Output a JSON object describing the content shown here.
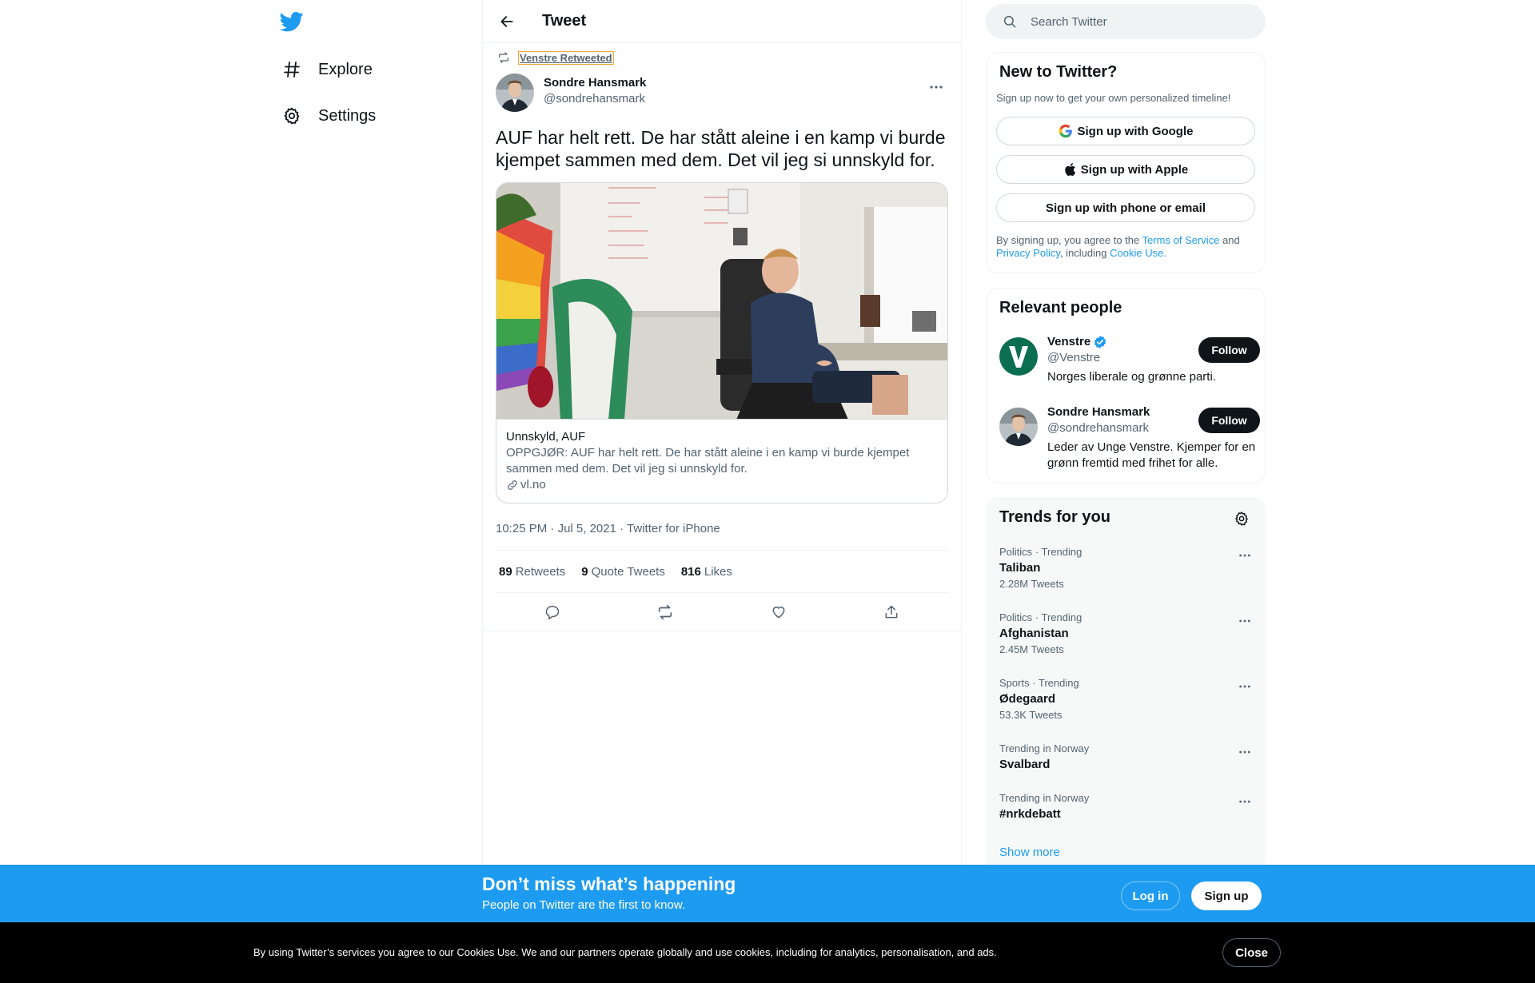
{
  "nav": {
    "logo_icon": "twitter-bird-icon",
    "items": [
      {
        "label": "Explore",
        "icon": "hashtag-icon"
      },
      {
        "label": "Settings",
        "icon": "gear-icon"
      }
    ]
  },
  "header": {
    "title": "Tweet",
    "back_icon": "arrow-left-icon"
  },
  "tweet": {
    "retweeted_by": "Venstre Retweeted",
    "author_name": "Sondre Hansmark",
    "author_handle": "@sondrehansmark",
    "text": "AUF har helt rett. De har stått aleine i en kamp vi burde kjempet sammen med dem. Det vil jeg si unnskyld for.",
    "card": {
      "title": "Unnskyld, AUF",
      "description": "OPPGJØR: AUF har helt rett. De har stått aleine i en kamp vi burde kjempet sammen med dem. Det vil jeg si unnskyld for.",
      "domain": "vl.no"
    },
    "time": "10:25 PM",
    "date": "Jul 5, 2021",
    "separator": "·",
    "source": "Twitter for iPhone",
    "stats": {
      "retweets": "89",
      "retweets_label": "Retweets",
      "quotes": "9",
      "quotes_label": "Quote Tweets",
      "likes": "816",
      "likes_label": "Likes"
    }
  },
  "search": {
    "placeholder": "Search Twitter"
  },
  "new_to_twitter": {
    "title": "New to Twitter?",
    "subtitle": "Sign up now to get your own personalized timeline!",
    "google": "Sign up with Google",
    "apple": "Sign up with Apple",
    "phone": "Sign up with phone or email",
    "legal_1": "By signing up, you agree to the",
    "tos": "Terms of Service",
    "legal_2": "and",
    "privacy": "Privacy Policy",
    "legal_3": ", including",
    "cookie": "Cookie Use."
  },
  "relevant_people": {
    "title": "Relevant people",
    "people": [
      {
        "name": "Venstre",
        "handle": "@Venstre",
        "bio": "Norges liberale og grønne parti.",
        "follow": "Follow",
        "verified": true
      },
      {
        "name": "Sondre Hansmark",
        "handle": "@sondrehansmark",
        "bio": "Leder av Unge Venstre. Kjemper for en grønn fremtid med frihet for alle.",
        "follow": "Follow",
        "verified": false
      }
    ]
  },
  "trends": {
    "title": "Trends for you",
    "items": [
      {
        "meta": "Politics · Trending",
        "name": "Taliban",
        "count": "2.28M Tweets"
      },
      {
        "meta": "Politics · Trending",
        "name": "Afghanistan",
        "count": "2.45M Tweets"
      },
      {
        "meta": "Sports · Trending",
        "name": "Ødegaard",
        "count": "53.3K Tweets"
      },
      {
        "meta": "Trending in Norway",
        "name": "Svalbard",
        "count": ""
      },
      {
        "meta": "Trending in Norway",
        "name": "#nrkdebatt",
        "count": ""
      }
    ],
    "show_more": "Show more"
  },
  "bottom_bar": {
    "title": "Don’t miss what’s happening",
    "subtitle": "People on Twitter are the first to know.",
    "login": "Log in",
    "signup": "Sign up"
  },
  "cookie_bar": {
    "text": "By using Twitter’s services you agree to our Cookies Use. We and our partners operate globally and use cookies, including for analytics, personalisation, and ads.",
    "close": "Close"
  },
  "colors": {
    "accent": "#1d9bf0",
    "text": "#0f1419",
    "secondary": "#536471",
    "border": "#eff3f4"
  }
}
